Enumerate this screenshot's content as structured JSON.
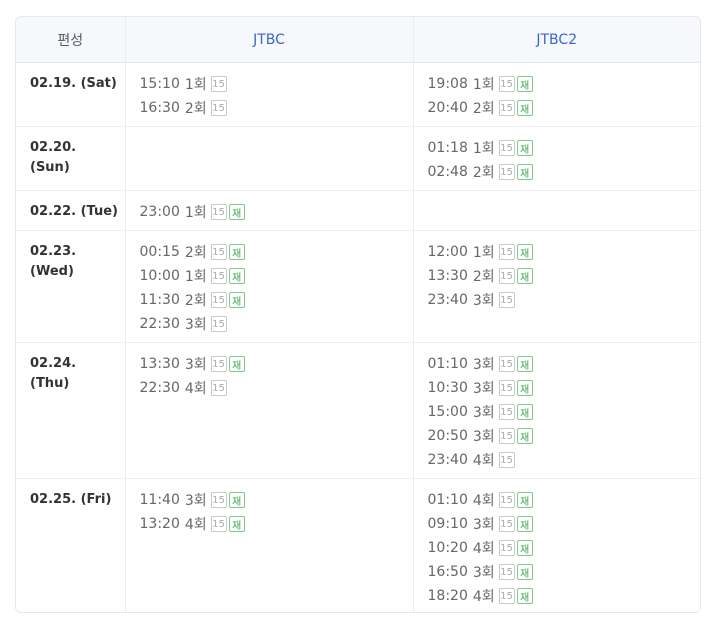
{
  "header": {
    "day_label": "편성",
    "channels": [
      "JTBC",
      "JTBC2"
    ]
  },
  "badges": {
    "rating": "15",
    "rerun": "재"
  },
  "rows": [
    {
      "date": "02.19. (Sat)",
      "jtbc": [
        {
          "time": "15:10",
          "ep": "1회",
          "rerun": false
        },
        {
          "time": "16:30",
          "ep": "2회",
          "rerun": false
        }
      ],
      "jtbc2": [
        {
          "time": "19:08",
          "ep": "1회",
          "rerun": true
        },
        {
          "time": "20:40",
          "ep": "2회",
          "rerun": true
        }
      ]
    },
    {
      "date": "02.20.\n(Sun)",
      "jtbc": [],
      "jtbc2": [
        {
          "time": "01:18",
          "ep": "1회",
          "rerun": true
        },
        {
          "time": "02:48",
          "ep": "2회",
          "rerun": true
        }
      ]
    },
    {
      "date": "02.22. (Tue)",
      "jtbc": [
        {
          "time": "23:00",
          "ep": "1회",
          "rerun": true
        }
      ],
      "jtbc2": []
    },
    {
      "date": "02.23.\n(Wed)",
      "jtbc": [
        {
          "time": "00:15",
          "ep": "2회",
          "rerun": true
        },
        {
          "time": "10:00",
          "ep": "1회",
          "rerun": true
        },
        {
          "time": "11:30",
          "ep": "2회",
          "rerun": true
        },
        {
          "time": "22:30",
          "ep": "3회",
          "rerun": false
        }
      ],
      "jtbc2": [
        {
          "time": "12:00",
          "ep": "1회",
          "rerun": true
        },
        {
          "time": "13:30",
          "ep": "2회",
          "rerun": true
        },
        {
          "time": "23:40",
          "ep": "3회",
          "rerun": false
        }
      ]
    },
    {
      "date": "02.24.\n(Thu)",
      "jtbc": [
        {
          "time": "13:30",
          "ep": "3회",
          "rerun": true
        },
        {
          "time": "22:30",
          "ep": "4회",
          "rerun": false
        }
      ],
      "jtbc2": [
        {
          "time": "01:10",
          "ep": "3회",
          "rerun": true
        },
        {
          "time": "10:30",
          "ep": "3회",
          "rerun": true
        },
        {
          "time": "15:00",
          "ep": "3회",
          "rerun": true
        },
        {
          "time": "20:50",
          "ep": "3회",
          "rerun": true
        },
        {
          "time": "23:40",
          "ep": "4회",
          "rerun": false
        }
      ]
    },
    {
      "date": "02.25. (Fri)",
      "jtbc": [
        {
          "time": "11:40",
          "ep": "3회",
          "rerun": true
        },
        {
          "time": "13:20",
          "ep": "4회",
          "rerun": true
        }
      ],
      "jtbc2": [
        {
          "time": "01:10",
          "ep": "4회",
          "rerun": true
        },
        {
          "time": "09:10",
          "ep": "3회",
          "rerun": true
        },
        {
          "time": "10:20",
          "ep": "4회",
          "rerun": true
        },
        {
          "time": "16:50",
          "ep": "3회",
          "rerun": true
        },
        {
          "time": "18:20",
          "ep": "4회",
          "rerun": true
        }
      ]
    }
  ]
}
